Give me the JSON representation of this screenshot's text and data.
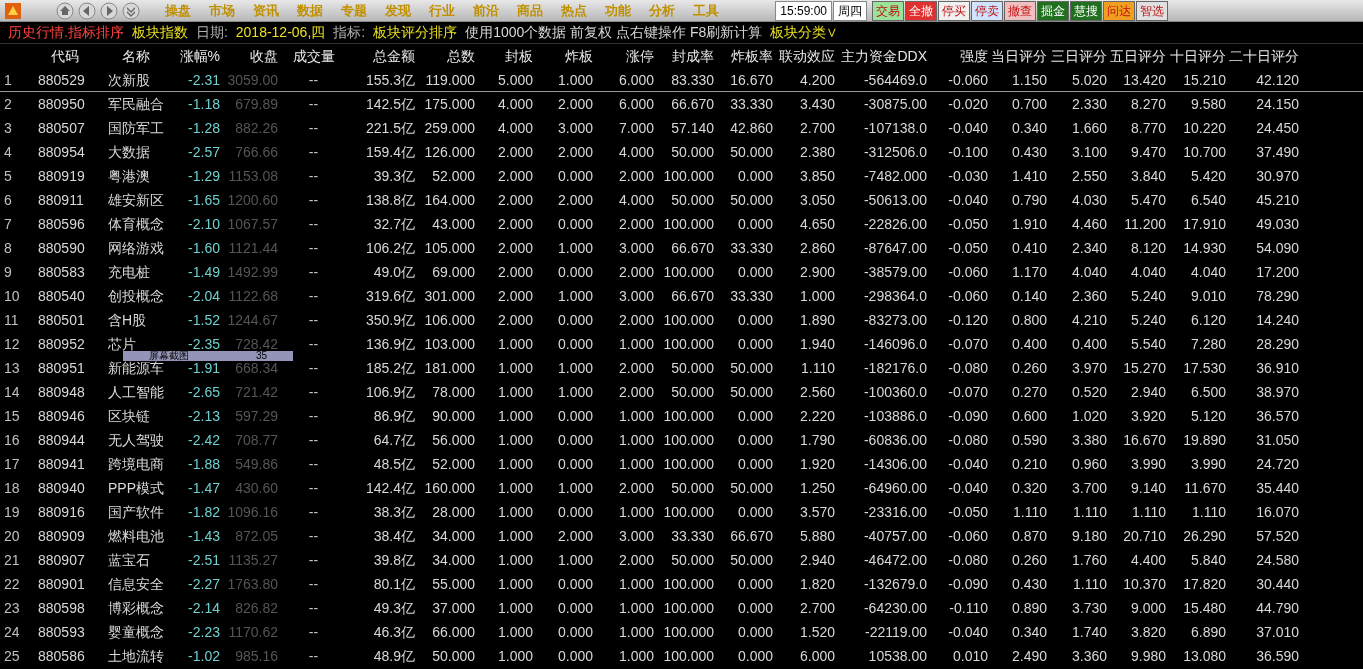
{
  "menu_bar": {
    "items": [
      "操盘",
      "市场",
      "资讯",
      "数据",
      "专题",
      "发现",
      "行业",
      "前沿",
      "商品",
      "热点",
      "功能",
      "分析",
      "工具"
    ],
    "time": "15:59:00",
    "weekday": "周四",
    "buttons": [
      {
        "label": "交易",
        "color": "#9be39b"
      },
      {
        "label": "全撤",
        "color": "#e03030"
      },
      {
        "label": "停买",
        "color": "#f0f0f0"
      },
      {
        "label": "停卖",
        "color": "#d0e4ff"
      },
      {
        "label": "撤查",
        "color": "#f0c0c0"
      },
      {
        "label": "掘金",
        "color": "#207020"
      },
      {
        "label": "慧搜",
        "color": "#207020"
      },
      {
        "label": "问达",
        "color": "#f0a020"
      },
      {
        "label": "智选",
        "color": "#e0e0e0"
      }
    ]
  },
  "info_bar": [
    {
      "text": "历史行情.指标排序",
      "kind": "title"
    },
    {
      "text": "板块指数",
      "kind": "value"
    },
    {
      "text": "日期:",
      "kind": "label"
    },
    {
      "text": "2018-12-06,四",
      "kind": "value"
    },
    {
      "text": "指标:",
      "kind": "label"
    },
    {
      "text": "板块评分排序",
      "kind": "value"
    },
    {
      "text": "使用1000个数据 前复权 点右键操作 F8刷新计算",
      "kind": "plain"
    },
    {
      "text": "板块分类∨",
      "kind": "value"
    }
  ],
  "table": {
    "columns": [
      {
        "kind": "index"
      },
      {
        "label": "代码",
        "kind": "text"
      },
      {
        "label": "名称",
        "kind": "text"
      },
      {
        "label": "涨幅%",
        "kind": "change"
      },
      {
        "label": "收盘",
        "kind": "dim"
      },
      {
        "label": "成交量",
        "kind": "center"
      },
      {
        "label": "总金额",
        "kind": "num"
      },
      {
        "label": "总数",
        "kind": "num"
      },
      {
        "label": "封板",
        "kind": "num"
      },
      {
        "label": "炸板",
        "kind": "num"
      },
      {
        "label": "涨停",
        "kind": "num"
      },
      {
        "label": "封成率",
        "kind": "num"
      },
      {
        "label": "炸板率",
        "kind": "num"
      },
      {
        "label": "联动效应",
        "kind": "num"
      },
      {
        "label": "主力资金DDX",
        "kind": "num"
      },
      {
        "label": "强度",
        "kind": "num"
      },
      {
        "label": "当日评分",
        "kind": "num"
      },
      {
        "label": "三日评分",
        "kind": "num"
      },
      {
        "label": "五日评分",
        "kind": "num"
      },
      {
        "label": "十日评分",
        "kind": "num"
      },
      {
        "label": "二十日评分",
        "kind": "num"
      }
    ],
    "rows": [
      {
        "selected": true,
        "cells": [
          "1",
          "880529",
          "次新股",
          "-2.31",
          "3059.00",
          "--",
          "155.3亿",
          "119.000",
          "5.000",
          "1.000",
          "6.000",
          "83.330",
          "16.670",
          "4.200",
          "-564469.0",
          "-0.060",
          "1.150",
          "5.020",
          "13.420",
          "15.210",
          "42.120"
        ]
      },
      {
        "selected": false,
        "cells": [
          "2",
          "880950",
          "军民融合",
          "-1.18",
          "679.89",
          "--",
          "142.5亿",
          "175.000",
          "4.000",
          "2.000",
          "6.000",
          "66.670",
          "33.330",
          "3.430",
          "-30875.00",
          "-0.020",
          "0.700",
          "2.330",
          "8.270",
          "9.580",
          "24.150"
        ]
      },
      {
        "selected": false,
        "cells": [
          "3",
          "880507",
          "国防军工",
          "-1.28",
          "882.26",
          "--",
          "221.5亿",
          "259.000",
          "4.000",
          "3.000",
          "7.000",
          "57.140",
          "42.860",
          "2.700",
          "-107138.0",
          "-0.040",
          "0.340",
          "1.660",
          "8.770",
          "10.220",
          "24.450"
        ]
      },
      {
        "selected": false,
        "cells": [
          "4",
          "880954",
          "大数据",
          "-2.57",
          "766.66",
          "--",
          "159.4亿",
          "126.000",
          "2.000",
          "2.000",
          "4.000",
          "50.000",
          "50.000",
          "2.380",
          "-312506.0",
          "-0.100",
          "0.430",
          "3.100",
          "9.470",
          "10.700",
          "37.490"
        ]
      },
      {
        "selected": false,
        "cells": [
          "5",
          "880919",
          "粤港澳",
          "-1.29",
          "1153.08",
          "--",
          "39.3亿",
          "52.000",
          "2.000",
          "0.000",
          "2.000",
          "100.000",
          "0.000",
          "3.850",
          "-7482.000",
          "-0.030",
          "1.410",
          "2.550",
          "3.840",
          "5.420",
          "30.970"
        ]
      },
      {
        "selected": false,
        "cells": [
          "6",
          "880911",
          "雄安新区",
          "-1.65",
          "1200.60",
          "--",
          "138.8亿",
          "164.000",
          "2.000",
          "2.000",
          "4.000",
          "50.000",
          "50.000",
          "3.050",
          "-50613.00",
          "-0.040",
          "0.790",
          "4.030",
          "5.470",
          "6.540",
          "45.210"
        ]
      },
      {
        "selected": false,
        "cells": [
          "7",
          "880596",
          "体育概念",
          "-2.10",
          "1067.57",
          "--",
          "32.7亿",
          "43.000",
          "2.000",
          "0.000",
          "2.000",
          "100.000",
          "0.000",
          "4.650",
          "-22826.00",
          "-0.050",
          "1.910",
          "4.460",
          "11.200",
          "17.910",
          "49.030"
        ]
      },
      {
        "selected": false,
        "cells": [
          "8",
          "880590",
          "网络游戏",
          "-1.60",
          "1121.44",
          "--",
          "106.2亿",
          "105.000",
          "2.000",
          "1.000",
          "3.000",
          "66.670",
          "33.330",
          "2.860",
          "-87647.00",
          "-0.050",
          "0.410",
          "2.340",
          "8.120",
          "14.930",
          "54.090"
        ]
      },
      {
        "selected": false,
        "cells": [
          "9",
          "880583",
          "充电桩",
          "-1.49",
          "1492.99",
          "--",
          "49.0亿",
          "69.000",
          "2.000",
          "0.000",
          "2.000",
          "100.000",
          "0.000",
          "2.900",
          "-38579.00",
          "-0.060",
          "1.170",
          "4.040",
          "4.040",
          "4.040",
          "17.200"
        ]
      },
      {
        "selected": false,
        "cells": [
          "10",
          "880540",
          "创投概念",
          "-2.04",
          "1122.68",
          "--",
          "319.6亿",
          "301.000",
          "2.000",
          "1.000",
          "3.000",
          "66.670",
          "33.330",
          "1.000",
          "-298364.0",
          "-0.060",
          "0.140",
          "2.360",
          "5.240",
          "9.010",
          "78.290"
        ]
      },
      {
        "selected": false,
        "cells": [
          "11",
          "880501",
          "含H股",
          "-1.52",
          "1244.67",
          "--",
          "350.9亿",
          "106.000",
          "2.000",
          "0.000",
          "2.000",
          "100.000",
          "0.000",
          "1.890",
          "-83273.00",
          "-0.120",
          "0.800",
          "4.210",
          "5.240",
          "6.120",
          "14.240"
        ]
      },
      {
        "selected": false,
        "cells": [
          "12",
          "880952",
          "芯片",
          "-2.35",
          "728.42",
          "--",
          "136.9亿",
          "103.000",
          "1.000",
          "0.000",
          "1.000",
          "100.000",
          "0.000",
          "1.940",
          "-146096.0",
          "-0.070",
          "0.400",
          "0.400",
          "5.540",
          "7.280",
          "28.290"
        ]
      },
      {
        "selected": false,
        "cells": [
          "13",
          "880951",
          "新能源车",
          "-1.91",
          "668.34",
          "--",
          "185.2亿",
          "181.000",
          "1.000",
          "1.000",
          "2.000",
          "50.000",
          "50.000",
          "1.110",
          "-182176.0",
          "-0.080",
          "0.260",
          "3.970",
          "15.270",
          "17.530",
          "36.910"
        ]
      },
      {
        "selected": false,
        "cells": [
          "14",
          "880948",
          "人工智能",
          "-2.65",
          "721.42",
          "--",
          "106.9亿",
          "78.000",
          "1.000",
          "1.000",
          "2.000",
          "50.000",
          "50.000",
          "2.560",
          "-100360.0",
          "-0.070",
          "0.270",
          "0.520",
          "2.940",
          "6.500",
          "38.970"
        ]
      },
      {
        "selected": false,
        "cells": [
          "15",
          "880946",
          "区块链",
          "-2.13",
          "597.29",
          "--",
          "86.9亿",
          "90.000",
          "1.000",
          "0.000",
          "1.000",
          "100.000",
          "0.000",
          "2.220",
          "-103886.0",
          "-0.090",
          "0.600",
          "1.020",
          "3.920",
          "5.120",
          "36.570"
        ]
      },
      {
        "selected": false,
        "cells": [
          "16",
          "880944",
          "无人驾驶",
          "-2.42",
          "708.77",
          "--",
          "64.7亿",
          "56.000",
          "1.000",
          "0.000",
          "1.000",
          "100.000",
          "0.000",
          "1.790",
          "-60836.00",
          "-0.080",
          "0.590",
          "3.380",
          "16.670",
          "19.890",
          "31.050"
        ]
      },
      {
        "selected": false,
        "cells": [
          "17",
          "880941",
          "跨境电商",
          "-1.88",
          "549.86",
          "--",
          "48.5亿",
          "52.000",
          "1.000",
          "0.000",
          "1.000",
          "100.000",
          "0.000",
          "1.920",
          "-14306.00",
          "-0.040",
          "0.210",
          "0.960",
          "3.990",
          "3.990",
          "24.720"
        ]
      },
      {
        "selected": false,
        "cells": [
          "18",
          "880940",
          "PPP模式",
          "-1.47",
          "430.60",
          "--",
          "142.4亿",
          "160.000",
          "1.000",
          "1.000",
          "2.000",
          "50.000",
          "50.000",
          "1.250",
          "-64960.00",
          "-0.040",
          "0.320",
          "3.700",
          "9.140",
          "11.670",
          "35.440"
        ]
      },
      {
        "selected": false,
        "cells": [
          "19",
          "880916",
          "国产软件",
          "-1.82",
          "1096.16",
          "--",
          "38.3亿",
          "28.000",
          "1.000",
          "0.000",
          "1.000",
          "100.000",
          "0.000",
          "3.570",
          "-23316.00",
          "-0.050",
          "1.110",
          "1.110",
          "1.110",
          "1.110",
          "16.070"
        ]
      },
      {
        "selected": false,
        "cells": [
          "20",
          "880909",
          "燃料电池",
          "-1.43",
          "872.05",
          "--",
          "38.4亿",
          "34.000",
          "1.000",
          "2.000",
          "3.000",
          "33.330",
          "66.670",
          "5.880",
          "-40757.00",
          "-0.060",
          "0.870",
          "9.180",
          "20.710",
          "26.290",
          "57.520"
        ]
      },
      {
        "selected": false,
        "cells": [
          "21",
          "880907",
          "蓝宝石",
          "-2.51",
          "1135.27",
          "--",
          "39.8亿",
          "34.000",
          "1.000",
          "1.000",
          "2.000",
          "50.000",
          "50.000",
          "2.940",
          "-46472.00",
          "-0.080",
          "0.260",
          "1.760",
          "4.400",
          "5.840",
          "24.580"
        ]
      },
      {
        "selected": false,
        "cells": [
          "22",
          "880901",
          "信息安全",
          "-2.27",
          "1763.80",
          "--",
          "80.1亿",
          "55.000",
          "1.000",
          "0.000",
          "1.000",
          "100.000",
          "0.000",
          "1.820",
          "-132679.0",
          "-0.090",
          "0.430",
          "1.110",
          "10.370",
          "17.820",
          "30.440"
        ]
      },
      {
        "selected": false,
        "cells": [
          "23",
          "880598",
          "博彩概念",
          "-2.14",
          "826.82",
          "--",
          "49.3亿",
          "37.000",
          "1.000",
          "0.000",
          "1.000",
          "100.000",
          "0.000",
          "2.700",
          "-64230.00",
          "-0.110",
          "0.890",
          "3.730",
          "9.000",
          "15.480",
          "44.790"
        ]
      },
      {
        "selected": false,
        "cells": [
          "24",
          "880593",
          "婴童概念",
          "-2.23",
          "1170.62",
          "--",
          "46.3亿",
          "66.000",
          "1.000",
          "0.000",
          "1.000",
          "100.000",
          "0.000",
          "1.520",
          "-22119.00",
          "-0.040",
          "0.340",
          "1.740",
          "3.820",
          "6.890",
          "37.010"
        ]
      },
      {
        "selected": false,
        "cells": [
          "25",
          "880586",
          "土地流转",
          "-1.02",
          "985.16",
          "--",
          "48.9亿",
          "50.000",
          "1.000",
          "0.000",
          "1.000",
          "100.000",
          "0.000",
          "6.000",
          "10538.00",
          "0.010",
          "2.490",
          "3.360",
          "9.980",
          "13.080",
          "36.590"
        ]
      }
    ]
  },
  "context_menu": {
    "label": "屏幕截图",
    "shortcut": "35"
  }
}
